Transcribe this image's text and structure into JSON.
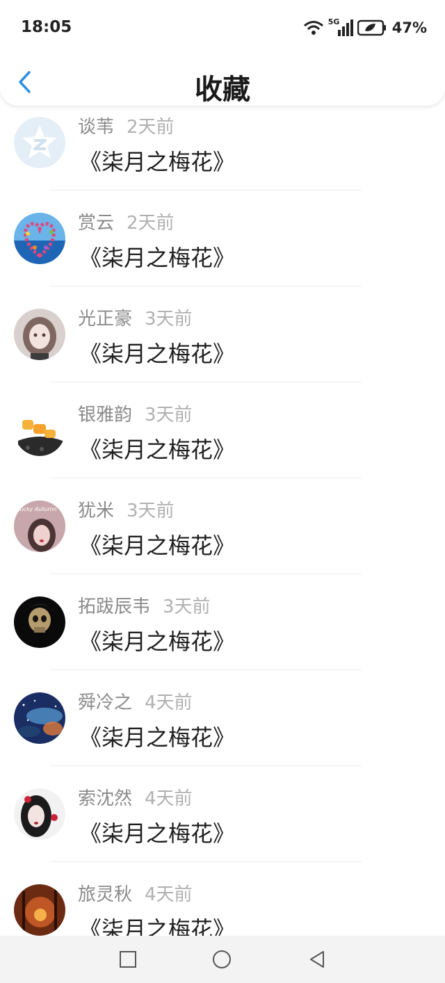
{
  "status_bar": {
    "time": "18:05",
    "network": "5G",
    "battery": "47%"
  },
  "header": {
    "title": "收藏"
  },
  "items": [
    {
      "user": "谈苇",
      "ago": "2天前",
      "book": "《柒月之梅花》"
    },
    {
      "user": "赏云",
      "ago": "2天前",
      "book": "《柒月之梅花》"
    },
    {
      "user": "光正豪",
      "ago": "3天前",
      "book": "《柒月之梅花》"
    },
    {
      "user": "银雅韵",
      "ago": "3天前",
      "book": "《柒月之梅花》"
    },
    {
      "user": "犹米",
      "ago": "3天前",
      "book": "《柒月之梅花》"
    },
    {
      "user": "拓跋辰韦",
      "ago": "3天前",
      "book": "《柒月之梅花》"
    },
    {
      "user": "舜冷之",
      "ago": "4天前",
      "book": "《柒月之梅花》"
    },
    {
      "user": "索沈然",
      "ago": "4天前",
      "book": "《柒月之梅花》"
    },
    {
      "user": "旅灵秋",
      "ago": "4天前",
      "book": "《柒月之梅花》"
    }
  ],
  "avatar_text": {
    "autumn": "Lucky Autumn"
  },
  "colors": {
    "accent": "#2d8fe0",
    "divider": "#eeeeee",
    "name": "#8a8a8a"
  }
}
